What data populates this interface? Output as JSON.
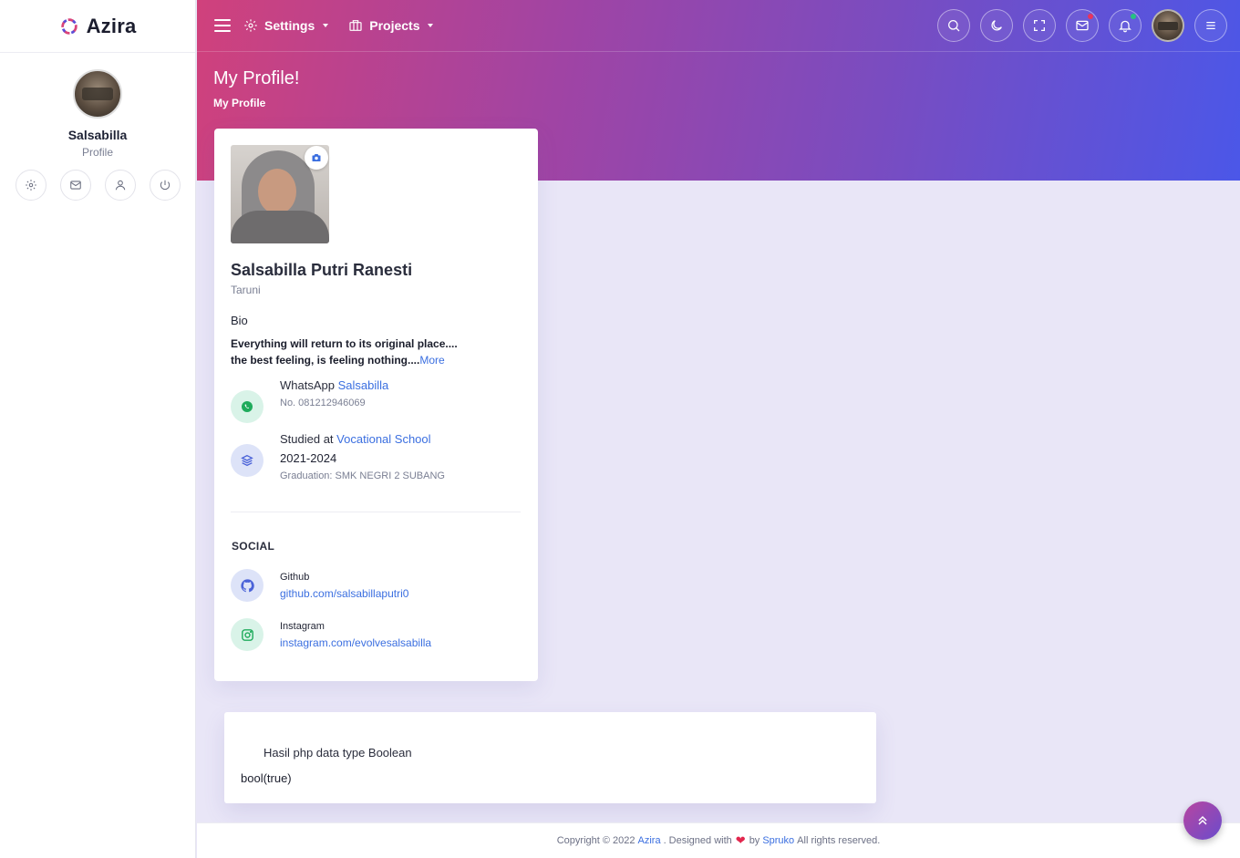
{
  "brand": {
    "name": "Azira"
  },
  "sidebar": {
    "user_name": "Salsabilla",
    "user_role": "Profile"
  },
  "topbar": {
    "settings_label": "Settings",
    "projects_label": "Projects"
  },
  "page": {
    "title": "My Profile!",
    "breadcrumb": "My Profile"
  },
  "profile": {
    "full_name": "Salsabilla Putri Ranesti",
    "subtitle": "Taruni",
    "bio_label": "Bio",
    "bio_line1": "Everything will return to its original place....",
    "bio_line2": "the best feeling, is feeling nothing....",
    "bio_more": "More",
    "whatsapp_label": "WhatsApp",
    "whatsapp_name": "Salsabilla",
    "whatsapp_number": "No. 081212946069",
    "studied_label": "Studied at",
    "studied_link": "Vocational School",
    "study_years": "2021-2024",
    "graduation": "Graduation: SMK NEGRI 2 SUBANG",
    "social_label": "SOCIAL",
    "github_label": "Github",
    "github_link": "github.com/salsabillaputri0",
    "instagram_label": "Instagram",
    "instagram_link": "instagram.com/evolvesalsabilla"
  },
  "result": {
    "heading": "Hasil php data type Boolean",
    "value": "bool(true)"
  },
  "footer": {
    "prefix": "Copyright © 2022",
    "brand_link": "Azira",
    "designed": ". Designed with",
    "by": "by",
    "company_link": "Spruko",
    "suffix": "All rights reserved."
  },
  "colors": {
    "accent": "#3b6fe0",
    "whatsapp_bg": "#d9f3e8",
    "whatsapp_icon": "#1fab5c",
    "study_bg": "#dde3f8",
    "study_icon": "#4a62d8",
    "github_bg": "#dde3f8",
    "instagram_bg": "#d9f3e8",
    "mail_dot": "#e8345d",
    "bell_dot": "#26c281"
  }
}
